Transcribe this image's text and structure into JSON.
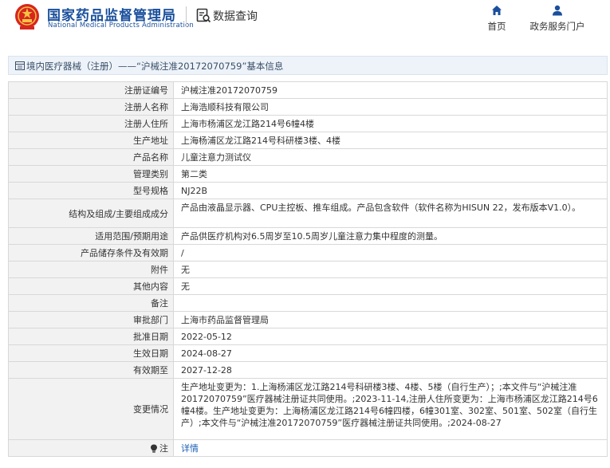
{
  "header": {
    "brand_cn": "国家药品监督管理局",
    "brand_en": "National Medical Products Administration",
    "query_label": "数据查询",
    "nav": [
      {
        "label": "首页",
        "icon": "home-icon"
      },
      {
        "label": "政务服务门户",
        "icon": "user-icon"
      }
    ]
  },
  "title": "境内医疗器械（注册）——“沪械注准20172070759”基本信息",
  "rows": [
    {
      "label": "注册证编号",
      "value": "沪械注准20172070759"
    },
    {
      "label": "注册人名称",
      "value": "上海浩顺科技有限公司"
    },
    {
      "label": "注册人住所",
      "value": "上海市杨浦区龙江路214号6幢4楼"
    },
    {
      "label": "生产地址",
      "value": "上海杨浦区龙江路214号科研楼3楼、4楼"
    },
    {
      "label": "产品名称",
      "value": "儿童注意力测试仪"
    },
    {
      "label": "管理类别",
      "value": "第二类"
    },
    {
      "label": "型号规格",
      "value": "NJ22B"
    },
    {
      "label": "结构及组成/主要组成成分",
      "value": "产品由液晶显示器、CPU主控板、推车组成。产品包含软件（软件名称为HISUN 22，发布版本V1.0）。"
    },
    {
      "label": "适用范围/预期用途",
      "value": "产品供医疗机构对6.5周岁至10.5周岁儿童注意力集中程度的测量。"
    },
    {
      "label": "产品储存条件及有效期",
      "value": "/"
    },
    {
      "label": "附件",
      "value": "无"
    },
    {
      "label": "其他内容",
      "value": "无"
    },
    {
      "label": "备注",
      "value": ""
    },
    {
      "label": "审批部门",
      "value": "上海市药品监督管理局"
    },
    {
      "label": "批准日期",
      "value": "2022-05-12"
    },
    {
      "label": "生效日期",
      "value": "2024-08-27"
    },
    {
      "label": "有效期至",
      "value": "2027-12-28"
    },
    {
      "label": "变更情况",
      "value": "生产地址变更为：1.上海杨浦区龙江路214号科研楼3楼、4楼、5楼（自行生产）；;本文件与“沪械注准20172070759”医疗器械注册证共同使用。;2023-11-14,注册人住所变更为：上海市杨浦区龙江路214号6幢4楼。生产地址变更为：上海杨浦区龙江路214号6幢四楼，6幢301室、302室、501室、502室（自行生产）;本文件与“沪械注准20172070759”医疗器械注册证共同使用。;2024-08-27"
    },
    {
      "label": "注",
      "value": "详情"
    }
  ]
}
